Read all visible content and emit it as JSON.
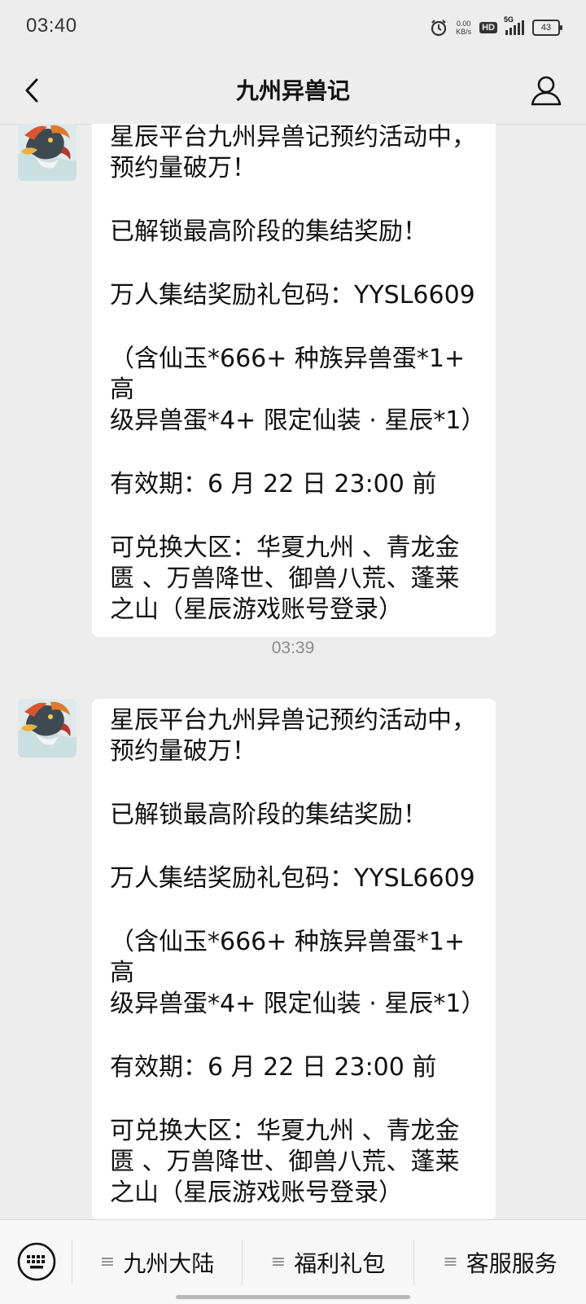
{
  "status_bar": {
    "time": "03:40",
    "net_speed_value": "0.00",
    "net_speed_unit": "KB/s",
    "hd_badge": "HD",
    "network": "5G",
    "battery": "43"
  },
  "header": {
    "title": "九州异兽记",
    "back_icon": "chevron-left-icon",
    "profile_icon": "person-icon"
  },
  "messages": [
    {
      "lines": [
        "星辰平台九州异兽记预约活动中，\n预约量破万！",
        "已解锁最高阶段的集结奖励！",
        "万人集结奖励礼包码：YYSL6609",
        "（含仙玉*666+ 种族异兽蛋*1+ 高\n级异兽蛋*4+ 限定仙装 · 星辰*1）",
        "有效期：6 月 22 日 23:00 前",
        "可兑换大区：华夏九州 、青龙金\n匮 、万兽降世、御兽八荒、蓬莱\n之山（星辰游戏账号登录）"
      ]
    },
    {
      "lines": [
        "星辰平台九州异兽记预约活动中，\n预约量破万！",
        "已解锁最高阶段的集结奖励！",
        "万人集结奖励礼包码：YYSL6609",
        "（含仙玉*666+ 种族异兽蛋*1+ 高\n级异兽蛋*4+ 限定仙装 · 星辰*1）",
        "有效期：6 月 22 日 23:00 前",
        "可兑换大区：华夏九州 、青龙金\n匮 、万兽降世、御兽八荒、蓬莱\n之山（星辰游戏账号登录）"
      ]
    }
  ],
  "timestamp": "03:39",
  "bottom_menu": {
    "keyboard_icon": "keyboard-icon",
    "items": [
      {
        "label": "九州大陆",
        "icon": "menu-lines-icon"
      },
      {
        "label": "福利礼包",
        "icon": "menu-lines-icon"
      },
      {
        "label": "客服服务",
        "icon": "menu-lines-icon"
      }
    ]
  },
  "colors": {
    "background": "#ededed",
    "bubble": "#ffffff",
    "timestamp": "#8a8a8a"
  }
}
